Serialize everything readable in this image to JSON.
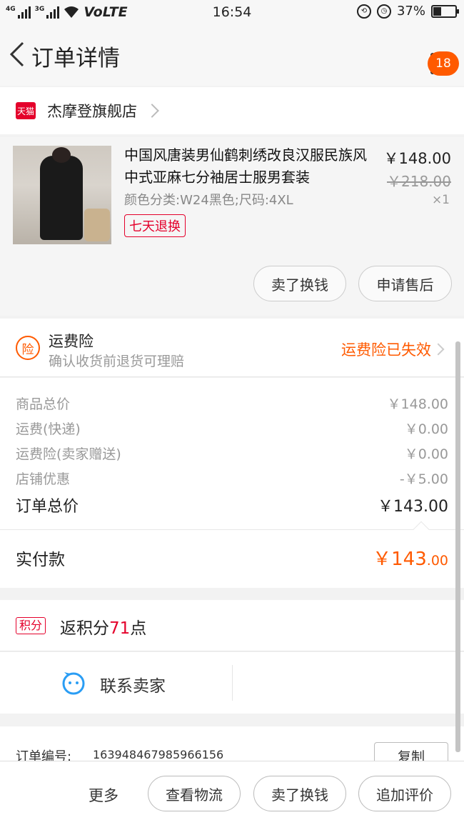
{
  "status_bar": {
    "net1": "4G",
    "net2": "3G",
    "volte": "VoLTE",
    "time": "16:54",
    "battery": "37%",
    "battery_level": 0.37
  },
  "nav": {
    "title": "订单详情",
    "badge": "18"
  },
  "shop": {
    "platform_tag": "天猫",
    "name": "杰摩登旗舰店"
  },
  "product": {
    "title": "中国风唐装男仙鹤刺绣改良汉服民族风中式亚麻七分袖居士服男套装",
    "spec": "颜色分类:W24黑色;尺码:4XL",
    "return_policy": "七天退换",
    "price": "￥148.00",
    "original_price": "￥218.00",
    "quantity": "×1",
    "buttons": [
      "卖了换钱",
      "申请售后"
    ]
  },
  "insurance": {
    "icon_text": "险",
    "title": "运费险",
    "subtitle": "确认收货前退货可理赔",
    "status": "运费险已失效"
  },
  "costs": [
    {
      "label": "商品总价",
      "value": "￥148.00"
    },
    {
      "label": "运费(快递)",
      "value": "￥0.00"
    },
    {
      "label": "运费险(卖家赠送)",
      "value": "￥0.00"
    },
    {
      "label": "店铺优惠",
      "value": "-￥5.00"
    }
  ],
  "order_total": {
    "label": "订单总价",
    "value": "￥143.00"
  },
  "paid": {
    "label": "实付款",
    "amount_int": "￥143",
    "amount_dec": ".00"
  },
  "points": {
    "tag": "积分",
    "prefix": "返积分",
    "number": "71",
    "suffix": "点"
  },
  "contact": {
    "label": "联系卖家"
  },
  "order": {
    "label": "订单编号:",
    "value": "163948467985966156",
    "copy_label": "复制"
  },
  "bottom_bar": {
    "more": "更多",
    "buttons": [
      "查看物流",
      "卖了换钱",
      "追加评价"
    ]
  },
  "colors": {
    "accent": "#ff5a00",
    "tmall_red": "#e4002b"
  }
}
